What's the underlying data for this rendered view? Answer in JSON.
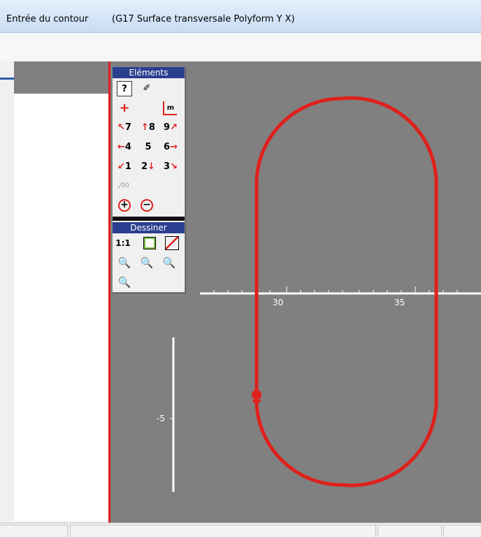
{
  "window": {
    "title_left": "Entrée du contour",
    "title_right": "(G17 Surface transversale Polyform   Y X)"
  },
  "palette_elements": {
    "title": "Eléments",
    "rows": [
      [
        {
          "name": "help-button",
          "label": "?"
        },
        {
          "name": "eraser-button",
          "label": "✐"
        }
      ],
      [
        {
          "name": "point-button",
          "label": "+"
        },
        {
          "name": "measure-button",
          "label": "m"
        }
      ],
      [
        {
          "name": "direction-7-button",
          "label": "7"
        },
        {
          "name": "direction-8-button",
          "label": "8"
        },
        {
          "name": "direction-9-button",
          "label": "9"
        }
      ],
      [
        {
          "name": "direction-4-button",
          "label": "4"
        },
        {
          "name": "direction-5-button",
          "label": "5"
        },
        {
          "name": "direction-6-button",
          "label": "6"
        }
      ],
      [
        {
          "name": "direction-1-button",
          "label": "1"
        },
        {
          "name": "direction-2-button",
          "label": "2"
        },
        {
          "name": "direction-3-button",
          "label": "3"
        }
      ],
      [
        {
          "name": "angle-30-button",
          "label": "30"
        }
      ],
      [
        {
          "name": "arc-cw-button",
          "label": "+"
        },
        {
          "name": "arc-ccw-button",
          "label": "−"
        }
      ]
    ]
  },
  "palette_draw": {
    "title": "Dessiner",
    "scale_label": "1:1"
  },
  "axis": {
    "x_ticks": [
      "30",
      "35"
    ],
    "y_ticks": [
      "-5"
    ]
  },
  "colors": {
    "contour": "#e0201c",
    "canvas_bg": "#808080",
    "palette_header": "#2a3f8f"
  }
}
